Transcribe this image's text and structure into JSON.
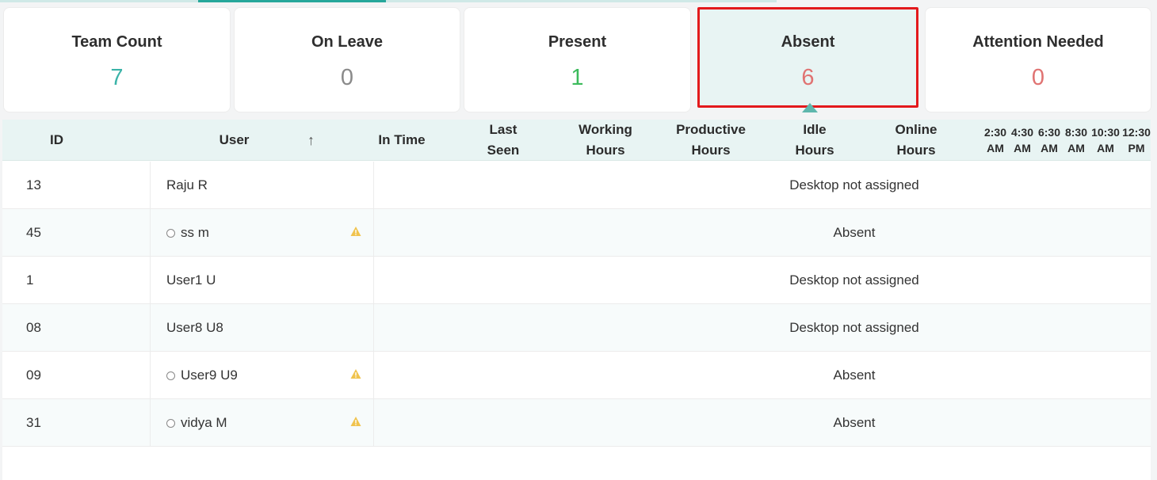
{
  "cards": [
    {
      "title": "Team Count",
      "count": "7",
      "color": "#3bb3a8"
    },
    {
      "title": "On Leave",
      "count": "0",
      "color": "#8a8a8a"
    },
    {
      "title": "Present",
      "count": "1",
      "color": "#3cbb5c"
    },
    {
      "title": "Absent",
      "count": "6",
      "color": "#e07372"
    },
    {
      "title": "Attention Needed",
      "count": "0",
      "color": "#e07372"
    }
  ],
  "selected_card": "Absent",
  "table": {
    "headers": {
      "id": "ID",
      "user": "User",
      "in_time": "In Time",
      "last_seen": [
        "Last",
        "Seen"
      ],
      "working_hours": [
        "Working",
        "Hours"
      ],
      "productive_hours": [
        "Productive",
        "Hours"
      ],
      "idle_hours": [
        "Idle",
        "Hours"
      ],
      "online_hours": [
        "Online",
        "Hours"
      ],
      "timeline": [
        {
          "time": "2:30",
          "period": "AM"
        },
        {
          "time": "4:30",
          "period": "AM"
        },
        {
          "time": "6:30",
          "period": "AM"
        },
        {
          "time": "8:30",
          "period": "AM"
        },
        {
          "time": "10:30",
          "period": "AM"
        },
        {
          "time": "12:30",
          "period": "PM"
        }
      ]
    },
    "rows": [
      {
        "id": "13",
        "user": "Raju R",
        "status": "Desktop not assigned",
        "warning": false
      },
      {
        "id": "45",
        "user": "ss m",
        "status": "Absent",
        "warning": true
      },
      {
        "id": "1",
        "user": "User1 U",
        "status": "Desktop not assigned",
        "warning": false
      },
      {
        "id": "08",
        "user": "User8 U8",
        "status": "Desktop not assigned",
        "warning": false
      },
      {
        "id": "09",
        "user": "User9 U9",
        "status": "Absent",
        "warning": true
      },
      {
        "id": "31",
        "user": "vidya M",
        "status": "Absent",
        "warning": true
      }
    ]
  },
  "colors": {
    "accent": "#27a79b",
    "selected_border": "#e3191c",
    "warning": "#f0c34e"
  }
}
